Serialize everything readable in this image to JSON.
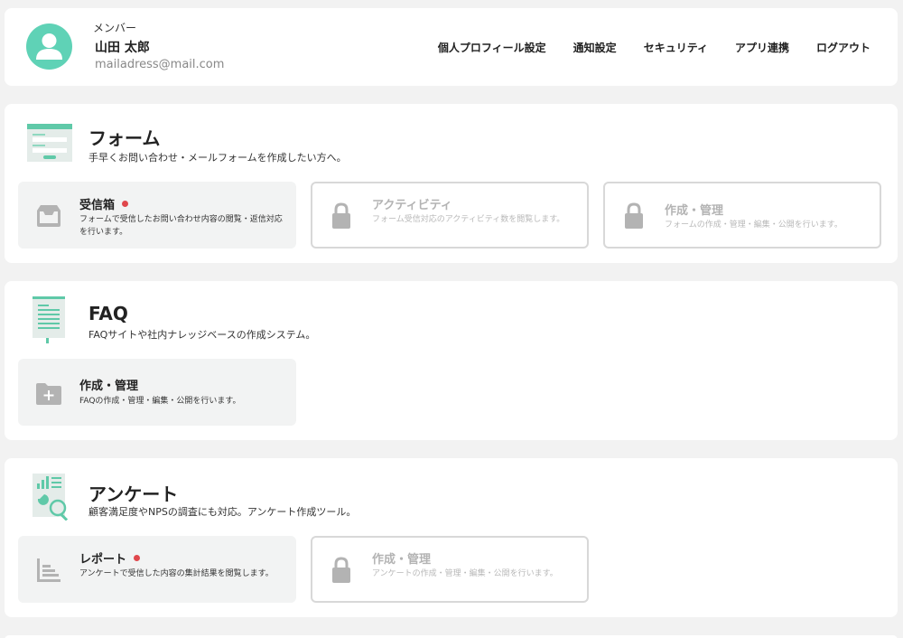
{
  "user": {
    "role": "メンバー",
    "name": "山田 太郎",
    "email": "mailadress@mail.com"
  },
  "nav": {
    "profile": "個人プロフィール設定",
    "notifications": "通知設定",
    "security": "セキュリティ",
    "integrations": "アプリ連携",
    "logout": "ログアウト"
  },
  "colors": {
    "accent": "#5fd2b6",
    "badge": "#e0474c",
    "locked": "#b3b3b3"
  },
  "sections": {
    "form": {
      "title": "フォーム",
      "description": "手早くお問い合わせ・メールフォームを作成したい方へ。",
      "tiles": [
        {
          "title": "受信箱",
          "description": "フォームで受信したお問い合わせ内容の閲覧・返信対応を行います。",
          "icon": "inbox-icon",
          "badge": true
        },
        {
          "title": "アクティビティ",
          "description": "フォーム受信対応のアクティビティ数を閲覧します。",
          "icon": "lock-icon"
        },
        {
          "title": "作成・管理",
          "description": "フォームの作成・管理・編集・公開を行います。",
          "icon": "lock-icon"
        }
      ]
    },
    "faq": {
      "title": "FAQ",
      "description": "FAQサイトや社内ナレッジベースの作成システム。",
      "tiles": [
        {
          "title": "作成・管理",
          "description": "FAQの作成・管理・編集・公開を行います。",
          "icon": "folder-plus-icon"
        }
      ]
    },
    "survey": {
      "title": "アンケート",
      "description": "顧客満足度やNPSの調査にも対応。アンケート作成ツール。",
      "tiles": [
        {
          "title": "レポート",
          "description": "アンケートで受信した内容の集計結果を閲覧します。",
          "icon": "report-icon",
          "badge": true
        },
        {
          "title": "作成・管理",
          "description": "アンケートの作成・管理・編集・公開を行います。",
          "icon": "lock-icon"
        }
      ]
    }
  }
}
